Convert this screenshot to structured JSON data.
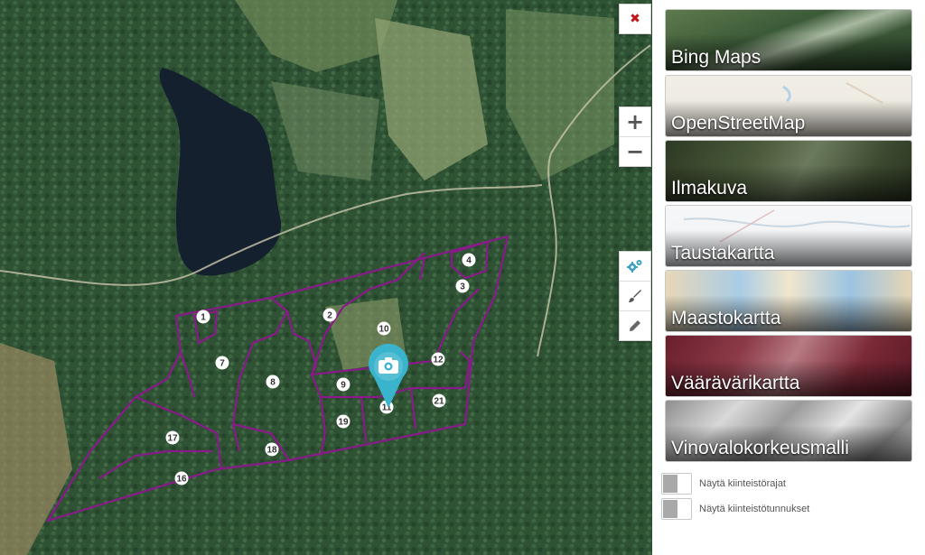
{
  "map": {
    "parcels": [
      {
        "label": "1"
      },
      {
        "label": "2"
      },
      {
        "label": "3"
      },
      {
        "label": "4"
      },
      {
        "label": "7"
      },
      {
        "label": "8"
      },
      {
        "label": "9"
      },
      {
        "label": "10"
      },
      {
        "label": "11"
      },
      {
        "label": "12"
      },
      {
        "label": "16"
      },
      {
        "label": "17"
      },
      {
        "label": "18"
      },
      {
        "label": "19"
      },
      {
        "label": "21"
      }
    ],
    "boundary_color": "#8a1a8a",
    "marker_color": "#3ab4cc",
    "marker_icon": "camera-icon"
  },
  "controls": {
    "close": {
      "icon": "close-icon",
      "glyph": "✖"
    },
    "zoom_in": {
      "icon": "plus-icon",
      "glyph": "+"
    },
    "zoom_out": {
      "icon": "minus-icon",
      "glyph": "−"
    },
    "tools": [
      {
        "icon": "settings-cogs-icon"
      },
      {
        "icon": "brush-icon"
      },
      {
        "icon": "pencil-icon"
      }
    ]
  },
  "layers": [
    {
      "label": "Bing Maps"
    },
    {
      "label": "OpenStreetMap"
    },
    {
      "label": "Ilmakuva"
    },
    {
      "label": "Taustakartta"
    },
    {
      "label": "Maastokartta"
    },
    {
      "label": "Väärävärikartta"
    },
    {
      "label": "Vinovalokorkeusmalli"
    }
  ],
  "toggles": [
    {
      "label": "Näytä kiinteistörajat"
    },
    {
      "label": "Näytä kiinteistötunnukset"
    }
  ]
}
